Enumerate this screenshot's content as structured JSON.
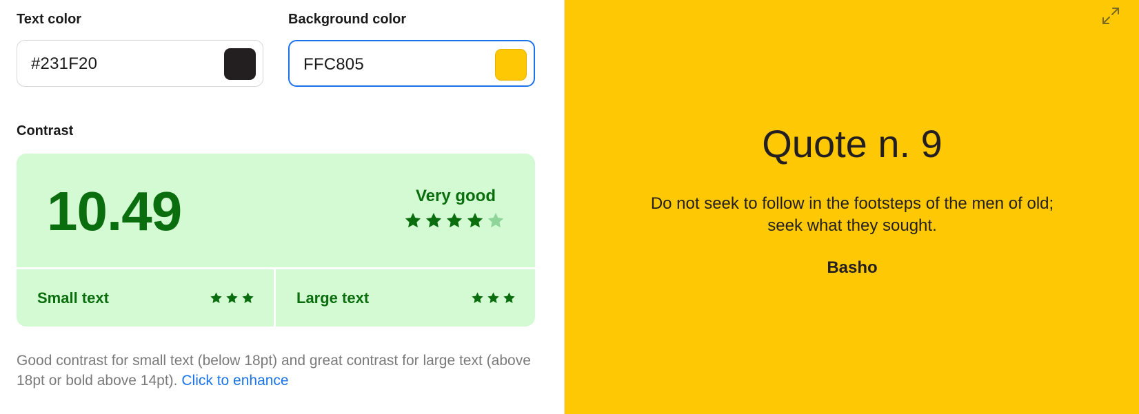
{
  "text_color": {
    "label": "Text color",
    "value": "#231F20",
    "swatch": "#231F20"
  },
  "background_color": {
    "label": "Background color",
    "value": "FFC805",
    "swatch": "#FFC805"
  },
  "contrast": {
    "label": "Contrast",
    "ratio": "10.49",
    "rating": "Very good",
    "stars_filled": 4,
    "stars_total": 5,
    "small_text": {
      "label": "Small text",
      "stars": 3
    },
    "large_text": {
      "label": "Large text",
      "stars": 3
    },
    "description": "Good contrast for small text (below 18pt) and great contrast for large text (above 18pt or bold above 14pt).",
    "enhance_link": "Click to enhance"
  },
  "preview": {
    "title": "Quote n. 9",
    "line1": "Do not seek to follow in the footsteps of the men of old;",
    "line2": "seek what they sought.",
    "author": "Basho",
    "expand_icon": "expand-icon"
  },
  "colors": {
    "accent_green": "#0B6E0E",
    "panel_green": "#D3FAD3",
    "star_faded": "#8FD59A",
    "link_blue": "#1a73e8"
  }
}
